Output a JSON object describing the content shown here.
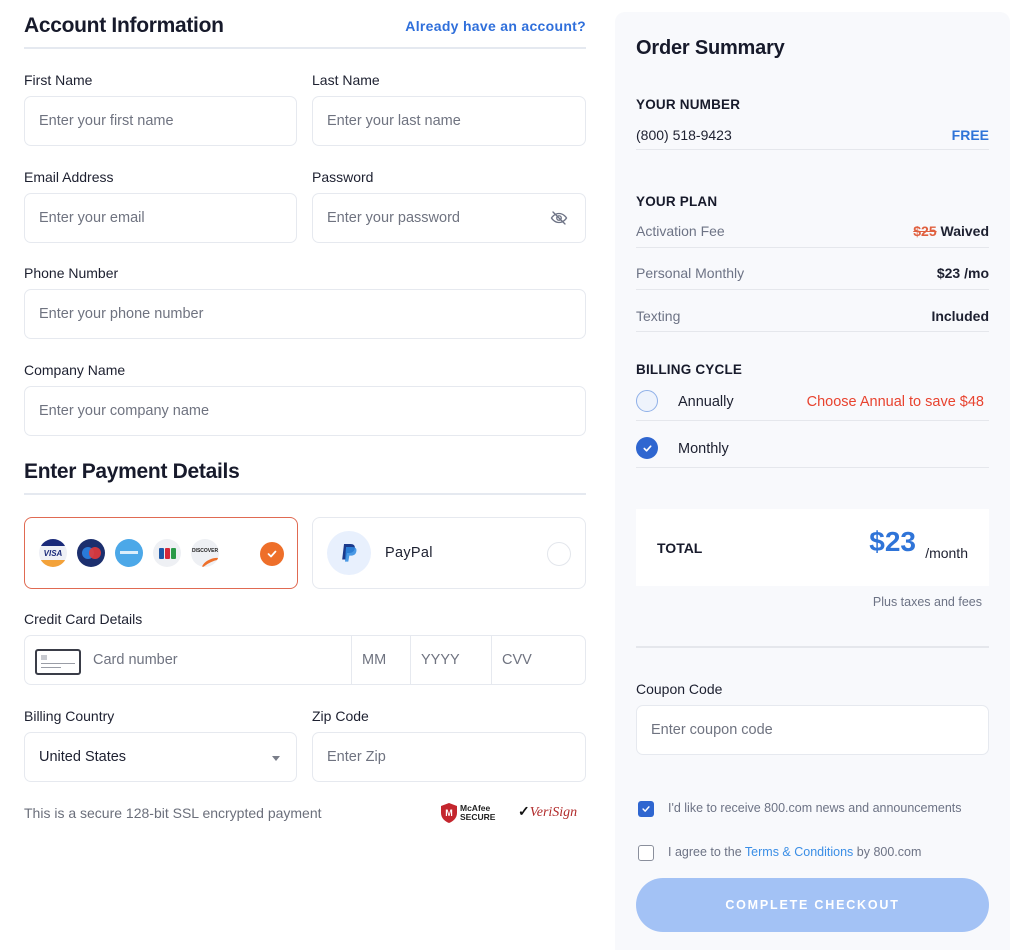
{
  "account": {
    "title": "Account Information",
    "signin_link": "Already have an account?",
    "fields": {
      "first_name": {
        "label": "First Name",
        "placeholder": "Enter your first name",
        "value": ""
      },
      "last_name": {
        "label": "Last Name",
        "placeholder": "Enter your last name",
        "value": ""
      },
      "email": {
        "label": "Email Address",
        "placeholder": "Enter your email",
        "value": ""
      },
      "password": {
        "label": "Password",
        "placeholder": "Enter your password",
        "value": "",
        "toggle_icon": "eye-off-icon"
      },
      "phone": {
        "label": "Phone Number",
        "placeholder": "Enter your phone number",
        "value": ""
      },
      "company": {
        "label": "Company Name",
        "placeholder": "Enter your company name",
        "value": ""
      }
    }
  },
  "payment": {
    "title": "Enter Payment Details",
    "methods": [
      {
        "id": "credit-card",
        "brands": [
          "VISA",
          "Maestro",
          "American Express",
          "JCB",
          "DISCOVER"
        ],
        "selected": true
      },
      {
        "id": "paypal",
        "label": "PayPal",
        "selected": false
      }
    ],
    "card": {
      "label": "Credit Card Details",
      "number_placeholder": "Card number",
      "month_placeholder": "MM",
      "year_placeholder": "YYYY",
      "cvv_placeholder": "CVV"
    },
    "country": {
      "label": "Billing Country",
      "value": "United States"
    },
    "zip": {
      "label": "Zip Code",
      "placeholder": "Enter Zip",
      "value": ""
    },
    "secure_note": "This is a secure 128-bit SSL encrypted payment",
    "badges": {
      "mcafee_top": "McAfee",
      "mcafee_bottom": "SECURE",
      "verisign": "VeriSign"
    }
  },
  "summary": {
    "title": "Order Summary",
    "number_section": {
      "heading": "YOUR NUMBER",
      "number": "(800) 518-9423",
      "price": "FREE"
    },
    "plan_section": {
      "heading": "YOUR PLAN",
      "rows": [
        {
          "label": "Activation Fee",
          "old": "$25",
          "value": "Waived"
        },
        {
          "label": "Personal Monthly",
          "value": "$23 /mo"
        },
        {
          "label": "Texting",
          "value": "Included"
        }
      ]
    },
    "billing": {
      "heading": "BILLING CYCLE",
      "options": [
        {
          "label": "Annually",
          "selected": false,
          "promo": "Choose Annual to save $48"
        },
        {
          "label": "Monthly",
          "selected": true
        }
      ]
    },
    "total": {
      "label": "TOTAL",
      "amount": "$23",
      "unit": "/month",
      "note": "Plus taxes and fees"
    },
    "coupon": {
      "label": "Coupon Code",
      "placeholder": "Enter coupon code",
      "value": ""
    },
    "checkboxes": {
      "news": {
        "text": "I'd like to receive 800.com news and announcements",
        "checked": true
      },
      "terms": {
        "prefix": "I agree to the ",
        "link": "Terms & Conditions",
        "suffix": " by 800.com",
        "checked": false
      }
    },
    "checkout_label": "COMPLETE CHECKOUT"
  },
  "colors": {
    "accent_blue": "#2f6fdb",
    "selected_border": "#e06a52",
    "check_orange": "#ee6f2a",
    "promo_red": "#e8432f",
    "checkout_disabled": "#a3c2f5"
  }
}
